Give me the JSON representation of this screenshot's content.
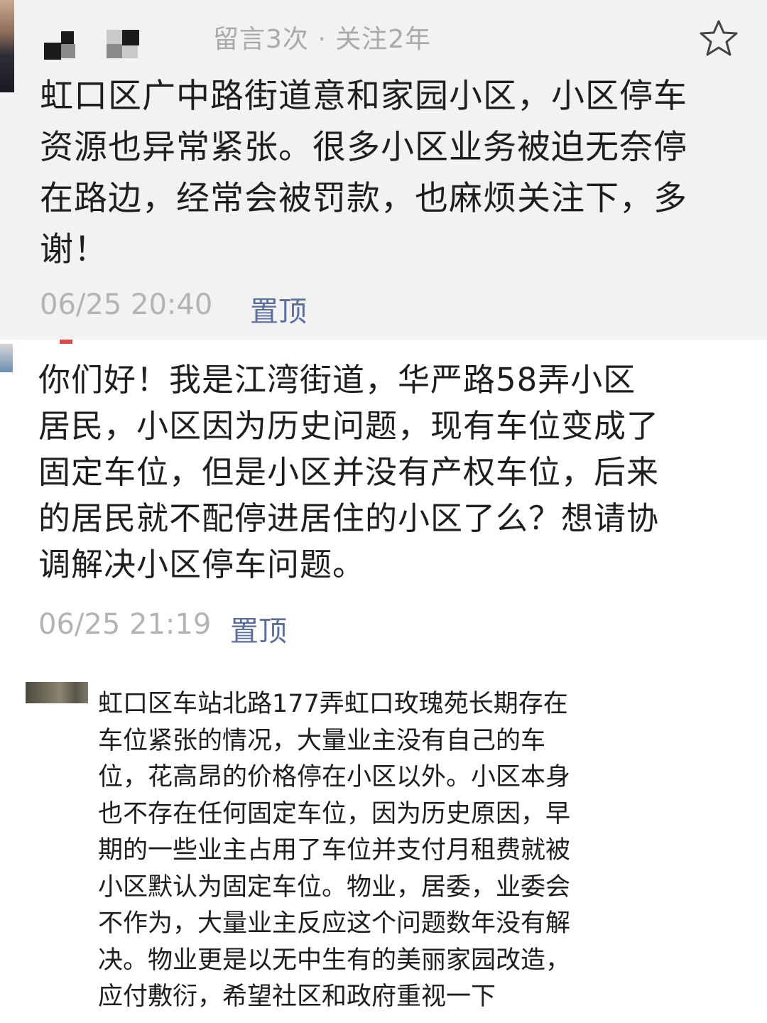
{
  "comments": [
    {
      "meta": "留言3次 · 关注2年",
      "text": "虹口区广中路街道意和家园小区，小区停车\n资源也异常紧张。很多小区业务被迫无奈停\n在路边，经常会被罚款，也麻烦关注下，多\n谢！",
      "time": "06/25 20:40",
      "pin_label": "置顶"
    },
    {
      "text": "你们好！我是江湾街道，华严路58弄小区\n居民，小区因为历史问题，现有车位变成了\n固定车位，但是小区并没有产权车位，后来\n的居民就不配停进居住的小区了么？想请协\n调解决小区停车问题。",
      "time": "06/25 21:19",
      "pin_label": "置顶"
    },
    {
      "text": "虹口区车站北路177弄虹口玫瑰苑长期存在\n车位紧张的情况，大量业主没有自己的车\n位，花高昂的价格停在小区以外。小区本身\n也不存在任何固定车位，因为历史原因，早\n期的一些业主占用了车位并支付月租费就被\n小区默认为固定车位。物业，居委，业委会\n不作为，大量业主反应这个问题数年没有解\n决。物业更是以无中生有的美丽家园改造，\n应付敷衍，希望社区和政府重视一下"
    }
  ],
  "icons": {
    "star": "star-outline-icon",
    "avatar": "pixelated-avatar"
  },
  "colors": {
    "panel_bg": "#f2f2f2",
    "meta_text": "#a9a9a9",
    "time_text": "#b3b3b3",
    "pin_text": "#5b6e9c",
    "body_text": "#1e1e1e"
  }
}
